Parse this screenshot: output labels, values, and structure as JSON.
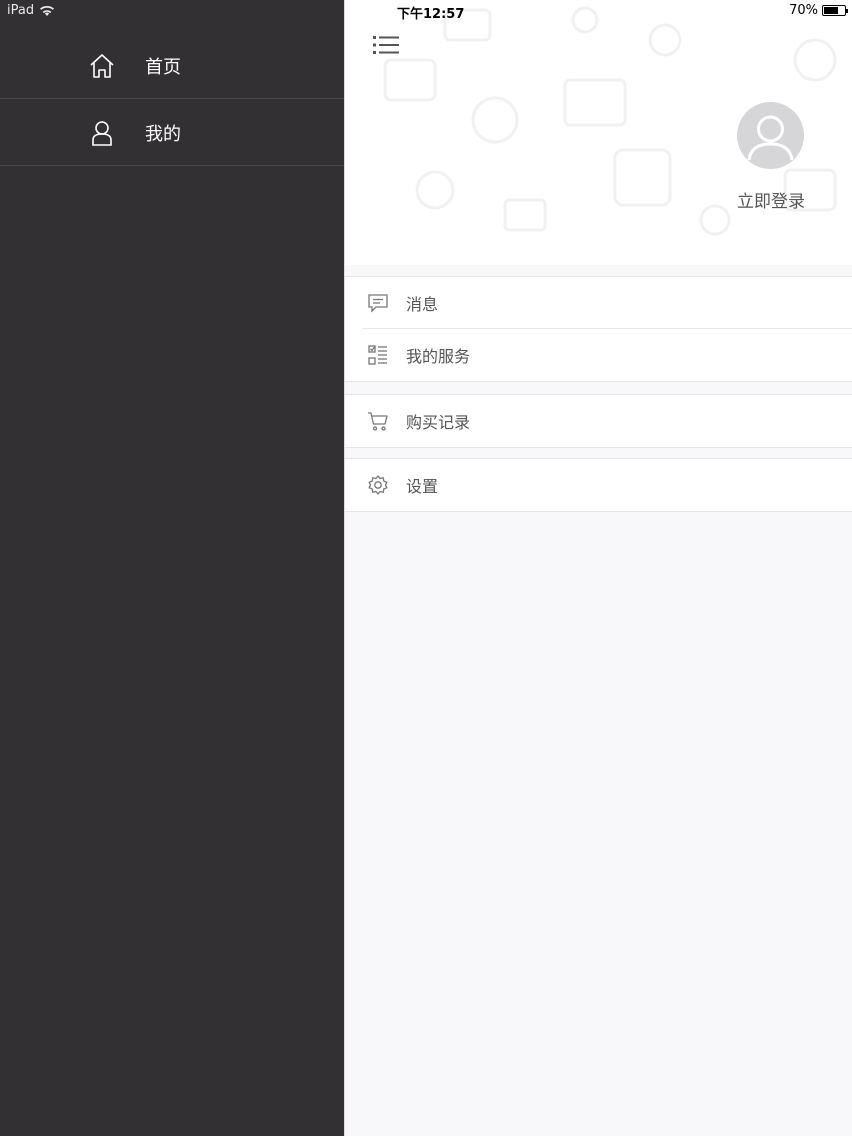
{
  "status_bar": {
    "carrier": "iPad",
    "time": "下午12:57",
    "battery_percent": "70%",
    "battery_level": 0.7
  },
  "drawer": {
    "items": [
      {
        "label": "首页",
        "icon": "home-icon"
      },
      {
        "label": "我的",
        "icon": "user-icon"
      }
    ]
  },
  "panel": {
    "menu_icon": "menu-icon",
    "login_label": "立即登录",
    "groups": [
      [
        {
          "label": "消息",
          "icon": "message-icon"
        },
        {
          "label": "我的服务",
          "icon": "service-list-icon"
        }
      ],
      [
        {
          "label": "购买记录",
          "icon": "cart-icon"
        }
      ],
      [
        {
          "label": "设置",
          "icon": "gear-icon"
        }
      ]
    ]
  },
  "colors": {
    "drawer_bg": "#323033",
    "panel_bg": "#f8f7fa",
    "text_gray": "#555555"
  }
}
